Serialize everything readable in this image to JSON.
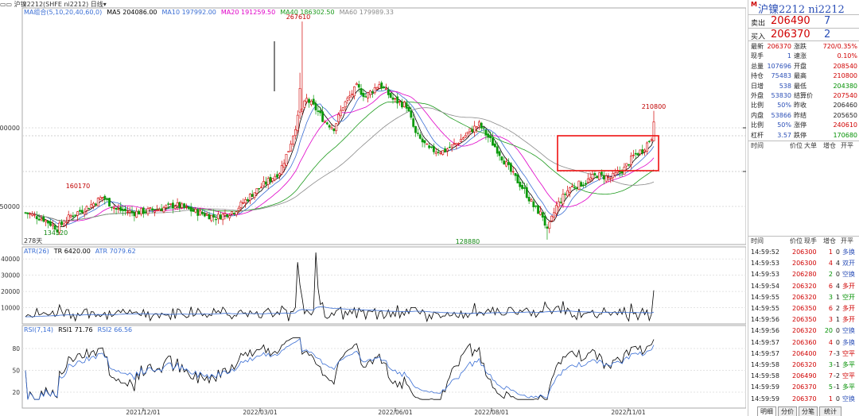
{
  "toolbar": {
    "instrument": "沪镍2212",
    "exchange": "(SHFE ni2212)",
    "period": "日线"
  },
  "ma_legend": {
    "name": "MA组合(5,10,20,40,60,0)",
    "items": [
      {
        "label": "MA5 204086.00",
        "color": "#000000"
      },
      {
        "label": "MA10 197992.00",
        "color": "#3a6ed4"
      },
      {
        "label": "MA20 191259.50",
        "color": "#e000c8"
      },
      {
        "label": "MA40 186302.50",
        "color": "#1c9a1c"
      },
      {
        "label": "MA60 179989.33",
        "color": "#8a8a8a"
      }
    ]
  },
  "atr_legend": {
    "name": "ATR(26)",
    "items": [
      {
        "label": "TR 6420.00",
        "color": "#000000"
      },
      {
        "label": "ATR 7079.62",
        "color": "#3a6ed4"
      }
    ]
  },
  "rsi_legend": {
    "name": "RSI(7,14)",
    "items": [
      {
        "label": "RSI1 71.76",
        "color": "#000000"
      },
      {
        "label": "RSI2 66.56",
        "color": "#3a6ed4"
      }
    ]
  },
  "chart_data": {
    "type": "candlestick",
    "main": {
      "y_ticks": [
        200000,
        150000
      ],
      "annotations": [
        {
          "label": "267610",
          "kind": "high"
        },
        {
          "label": "160170",
          "kind": "high"
        },
        {
          "label": "134520",
          "kind": "low"
        },
        {
          "label": "128880",
          "kind": "low"
        },
        {
          "label": "210800",
          "kind": "high"
        }
      ],
      "bars_label": "278天",
      "highlight_box": true,
      "grid": true
    },
    "atr": {
      "y_ticks": [
        40000,
        30000,
        20000,
        10000
      ]
    },
    "rsi": {
      "y_ticks": [
        80,
        50,
        20
      ]
    },
    "x_ticks": [
      "2021/12/01",
      "2022/03/01",
      "2022/06/01",
      "2022/08/01",
      "2022/11/01"
    ]
  },
  "panel": {
    "marker": "M",
    "title": "沪镍2212 ni2212",
    "sell": {
      "label": "卖出",
      "price": "206490",
      "vol": "7"
    },
    "buy": {
      "label": "买入",
      "price": "206370",
      "vol": "2"
    },
    "stats": [
      {
        "l1": "最新",
        "v1": "206370",
        "c1": "red",
        "l2": "涨跌",
        "v2": "720/0.35%",
        "c2": "red"
      },
      {
        "l1": "现手",
        "v1": "1",
        "c1": "blue",
        "l2": "速涨",
        "v2": "0.10%",
        "c2": "red"
      },
      {
        "l1": "总量",
        "v1": "107696",
        "c1": "blue",
        "l2": "开盘",
        "v2": "208540",
        "c2": "red"
      },
      {
        "l1": "持仓",
        "v1": "75483",
        "c1": "blue",
        "l2": "最高",
        "v2": "210800",
        "c2": "red"
      },
      {
        "l1": "日增",
        "v1": "538",
        "c1": "blue",
        "l2": "最低",
        "v2": "204380",
        "c2": "green"
      },
      {
        "l1": "外盘",
        "v1": "53830",
        "c1": "blue",
        "l2": "结算价",
        "v2": "207540",
        "c2": "red"
      },
      {
        "l1": "比例",
        "v1": "50%",
        "c1": "blue",
        "l2": "昨收",
        "v2": "206460",
        "c2": "blk"
      },
      {
        "l1": "内盘",
        "v1": "53866",
        "c1": "blue",
        "l2": "昨结",
        "v2": "205650",
        "c2": "blk"
      },
      {
        "l1": "比例",
        "v1": "50%",
        "c1": "blue",
        "l2": "涨停",
        "v2": "240610",
        "c2": "red"
      },
      {
        "l1": "杠杆",
        "v1": "3.57",
        "c1": "blue",
        "l2": "跌停",
        "v2": "170680",
        "c2": "green"
      }
    ],
    "header1": [
      "时间",
      "价位",
      "大单",
      "增仓",
      "开平"
    ],
    "header2": [
      "时间",
      "价位",
      "现手",
      "增仓",
      "开平"
    ],
    "ticks": [
      {
        "t": "14:59:52",
        "p": "206300",
        "v": "1",
        "vc": "red",
        "o": "0",
        "ty": "多换",
        "tc": "blue"
      },
      {
        "t": "14:59:53",
        "p": "206300",
        "v": "4",
        "vc": "red",
        "o": "4",
        "ty": "双开",
        "tc": "blue"
      },
      {
        "t": "14:59:53",
        "p": "206280",
        "v": "2",
        "vc": "green",
        "o": "0",
        "ty": "空换",
        "tc": "blue"
      },
      {
        "t": "14:59:54",
        "p": "206320",
        "v": "6",
        "vc": "red",
        "o": "4",
        "ty": "多开",
        "tc": "red"
      },
      {
        "t": "14:59:55",
        "p": "206320",
        "v": "3",
        "vc": "green",
        "o": "1",
        "ty": "空开",
        "tc": "green"
      },
      {
        "t": "14:59:55",
        "p": "206350",
        "v": "6",
        "vc": "red",
        "o": "2",
        "ty": "多开",
        "tc": "red"
      },
      {
        "t": "14:59:56",
        "p": "206350",
        "v": "3",
        "vc": "red",
        "o": "1",
        "ty": "多开",
        "tc": "red"
      },
      {
        "t": "14:59:56",
        "p": "206320",
        "v": "20",
        "vc": "green",
        "o": "0",
        "ty": "空换",
        "tc": "blue"
      },
      {
        "t": "14:59:57",
        "p": "206360",
        "v": "4",
        "vc": "red",
        "o": "0",
        "ty": "多换",
        "tc": "blue"
      },
      {
        "t": "14:59:57",
        "p": "206400",
        "v": "7",
        "vc": "red",
        "o": "-3",
        "ty": "空平",
        "tc": "red"
      },
      {
        "t": "14:59:58",
        "p": "206320",
        "v": "3",
        "vc": "green",
        "o": "-1",
        "ty": "多平",
        "tc": "green"
      },
      {
        "t": "14:59:58",
        "p": "206490",
        "v": "7",
        "vc": "red",
        "o": "-2",
        "ty": "空平",
        "tc": "red"
      },
      {
        "t": "14:59:59",
        "p": "206370",
        "v": "5",
        "vc": "green",
        "o": "-1",
        "ty": "多平",
        "tc": "green"
      },
      {
        "t": "14:59:59",
        "p": "206370",
        "v": "1",
        "vc": "red",
        "o": "0",
        "ty": "空换",
        "tc": "blue"
      }
    ],
    "tabs": [
      "明细",
      "分价",
      "分笔",
      "统计"
    ]
  }
}
